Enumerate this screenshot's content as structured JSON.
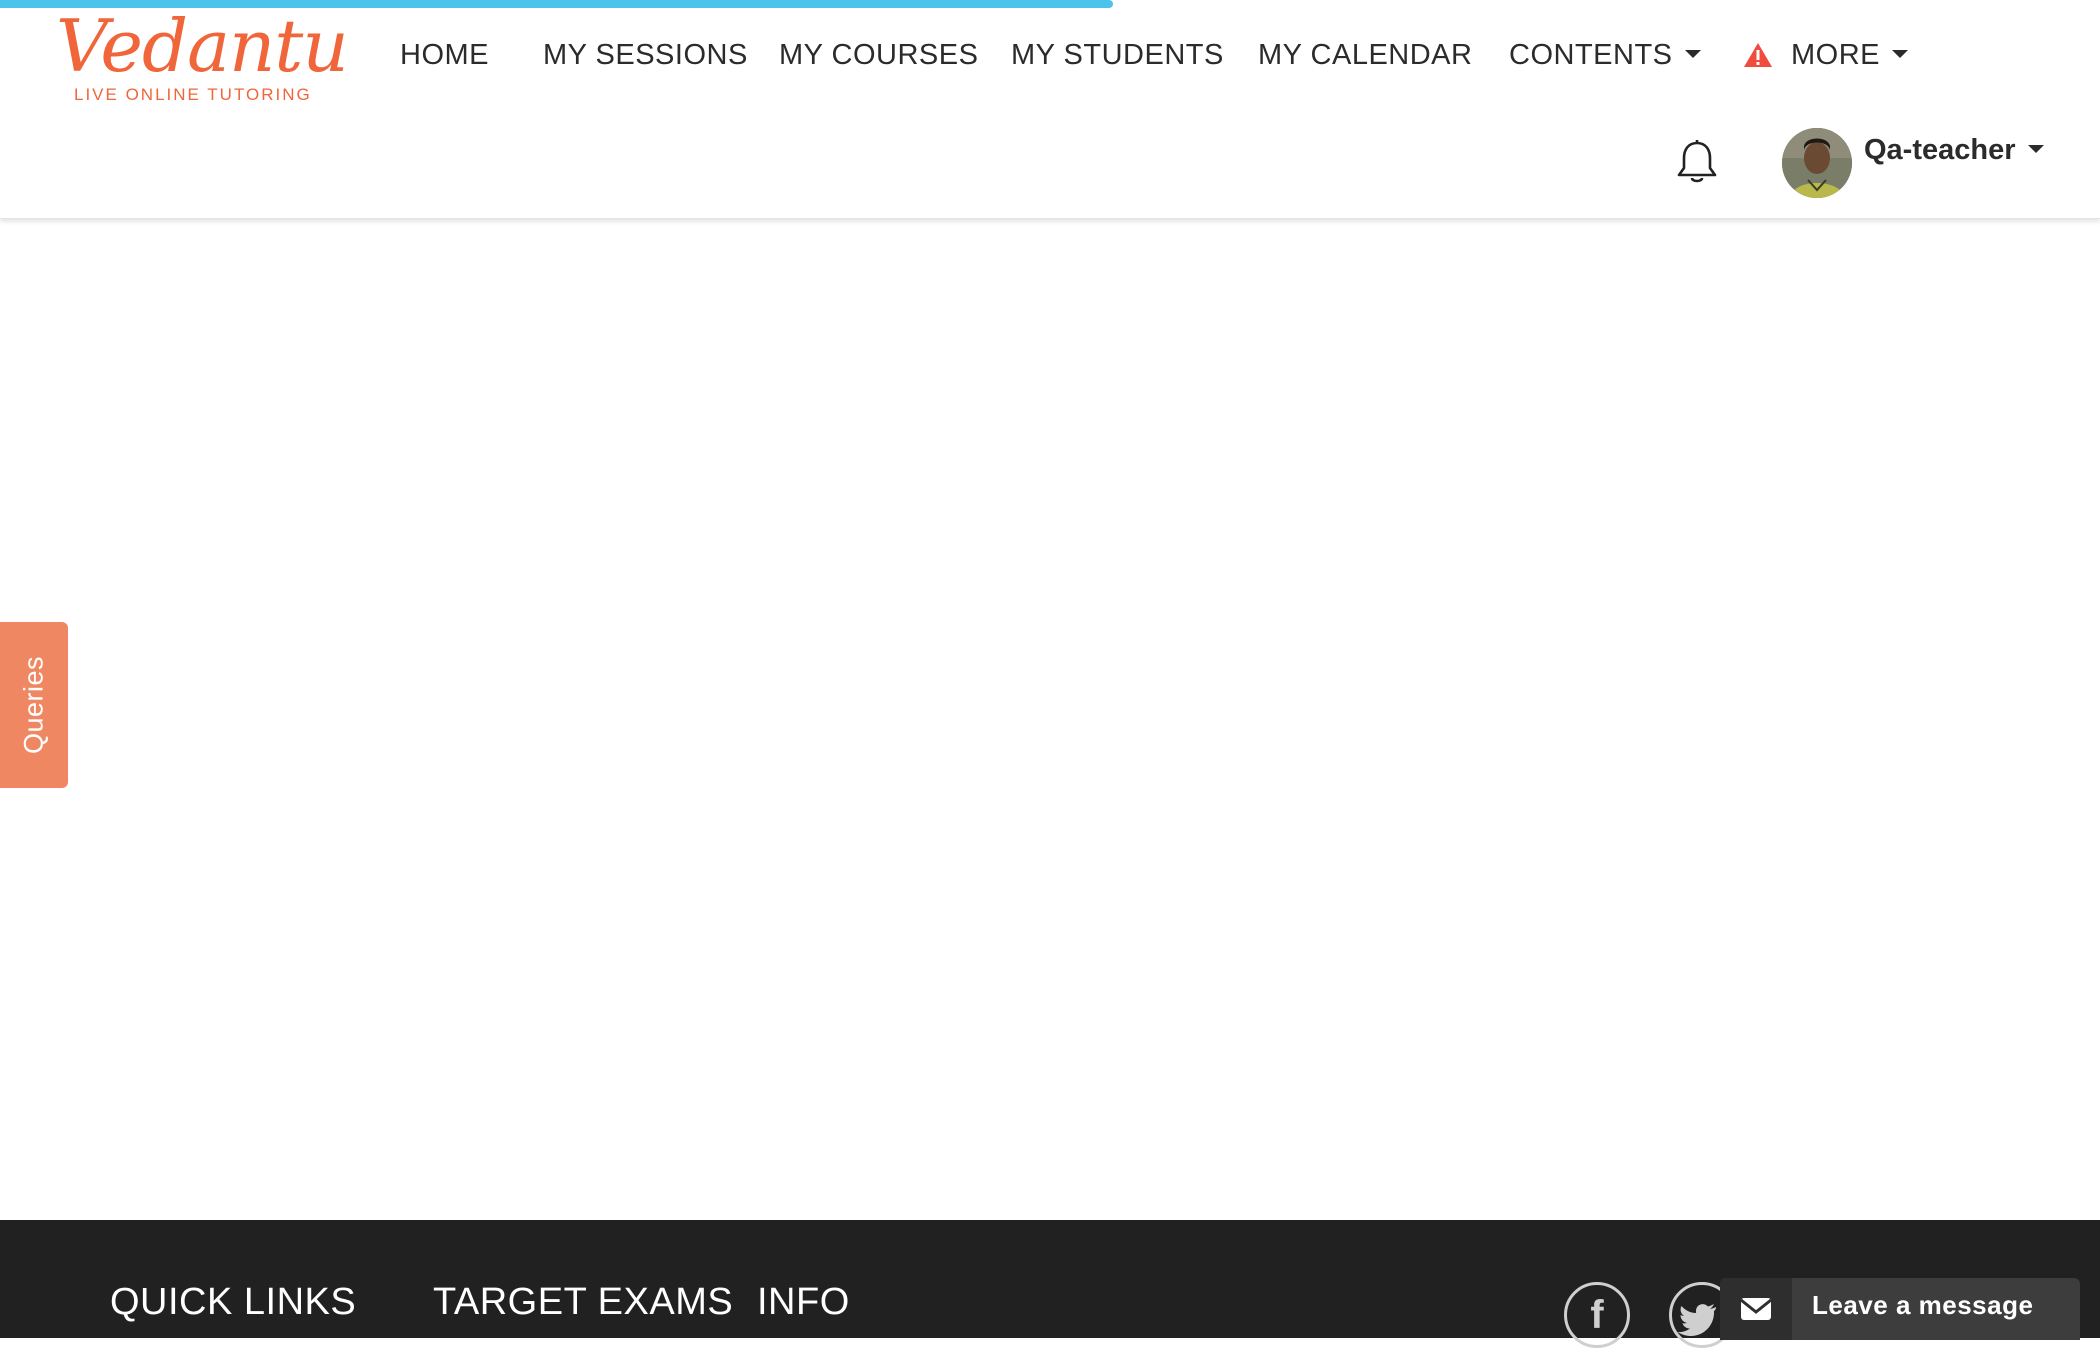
{
  "brand": {
    "logo_text": "Vedantu",
    "tagline": "LIVE ONLINE TUTORING",
    "accent_color": "#f0663a",
    "progress_color": "#4cc3ea"
  },
  "page_load_progress": 0.53,
  "nav": {
    "items": [
      {
        "label": "HOME"
      },
      {
        "label": "MY SESSIONS"
      },
      {
        "label": "MY COURSES"
      },
      {
        "label": "MY STUDENTS"
      },
      {
        "label": "MY CALENDAR"
      },
      {
        "label": "CONTENTS",
        "icon": "chevron-down-icon"
      },
      {
        "label": "MORE",
        "icon": "chevron-down-icon",
        "alert_icon": "warning-icon"
      }
    ]
  },
  "user": {
    "name": "Qa-teacher",
    "notification_icon": "bell-icon"
  },
  "queries_tab": {
    "label": "Queries",
    "color": "#ef8862"
  },
  "footer": {
    "headings": [
      "QUICK LINKS",
      "TARGET EXAMS",
      "INFO"
    ],
    "social_icons": [
      "facebook-icon",
      "twitter-icon"
    ],
    "background": "#212121"
  },
  "chat_widget": {
    "label": "Leave a message",
    "icon": "envelope-icon"
  }
}
